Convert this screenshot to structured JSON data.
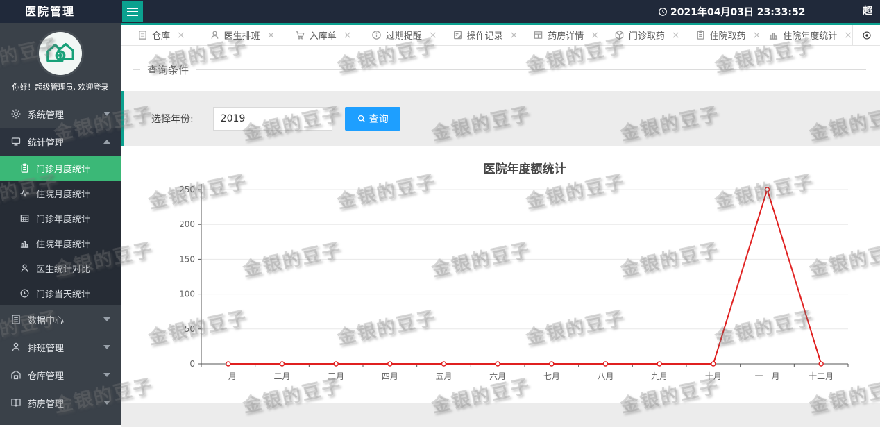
{
  "header": {
    "app_title": "医院管理",
    "datetime": "2021年04月03日 23:33:52",
    "user_abbrev": "超",
    "colors": {
      "bar": "#20293a",
      "accent": "#0ba18f"
    }
  },
  "tabs": {
    "items": [
      {
        "label": "仓库",
        "icon": "document-icon"
      },
      {
        "label": "医生排班",
        "icon": "user-icon"
      },
      {
        "label": "入库单",
        "icon": "cart-icon"
      },
      {
        "label": "过期提醒",
        "icon": "info-icon"
      },
      {
        "label": "操作记录",
        "icon": "memo-icon"
      },
      {
        "label": "药房详情",
        "icon": "layout-icon"
      },
      {
        "label": "门诊取药",
        "icon": "package-icon"
      },
      {
        "label": "住院取药",
        "icon": "clipboard-icon"
      },
      {
        "label": "住院年度统计",
        "icon": "bar-chart-icon"
      }
    ]
  },
  "sidebar": {
    "greeting": "你好！超级管理员, 欢迎登录",
    "groups_top": [
      {
        "label": "系统管理",
        "icon": "gear-icon",
        "state": "collapsed"
      },
      {
        "label": "统计管理",
        "icon": "monitor-icon",
        "state": "expanded"
      }
    ],
    "submenu": [
      {
        "label": "门诊月度统计",
        "icon": "clipboard-icon",
        "active": true
      },
      {
        "label": "住院月度统计",
        "icon": "pulse-icon",
        "active": false
      },
      {
        "label": "门诊年度统计",
        "icon": "table-icon",
        "active": false
      },
      {
        "label": "住院年度统计",
        "icon": "bar-chart-icon",
        "active": false
      },
      {
        "label": "医生统计对比",
        "icon": "user-icon",
        "active": false
      },
      {
        "label": "门诊当天统计",
        "icon": "clock-icon",
        "active": false
      }
    ],
    "groups_bottom": [
      {
        "label": "数据中心",
        "icon": "document-icon"
      },
      {
        "label": "排班管理",
        "icon": "user-icon"
      },
      {
        "label": "仓库管理",
        "icon": "warehouse-icon"
      },
      {
        "label": "药房管理",
        "icon": "book-icon"
      }
    ],
    "active_color": "#3bb877"
  },
  "query": {
    "section_title": "查询条件",
    "year_label": "选择年份:",
    "year_value": "2019",
    "search_button": "查询",
    "button_color": "#1E9FFF"
  },
  "chart_data": {
    "type": "line",
    "title": "医院年度额统计",
    "categories": [
      "一月",
      "二月",
      "三月",
      "四月",
      "五月",
      "六月",
      "七月",
      "八月",
      "九月",
      "十月",
      "十一月",
      "十二月"
    ],
    "series": [
      {
        "values": [
          0,
          0,
          0,
          0,
          0,
          0,
          0,
          0,
          0,
          0,
          250,
          0
        ],
        "color": "#e02020"
      }
    ],
    "xlabel": "",
    "ylabel": "",
    "ylim": [
      0,
      250
    ],
    "yticks": [
      0,
      50,
      100,
      150,
      200,
      250
    ],
    "grid": true,
    "legend": "none"
  },
  "watermark": {
    "text": "金银的豆子"
  }
}
